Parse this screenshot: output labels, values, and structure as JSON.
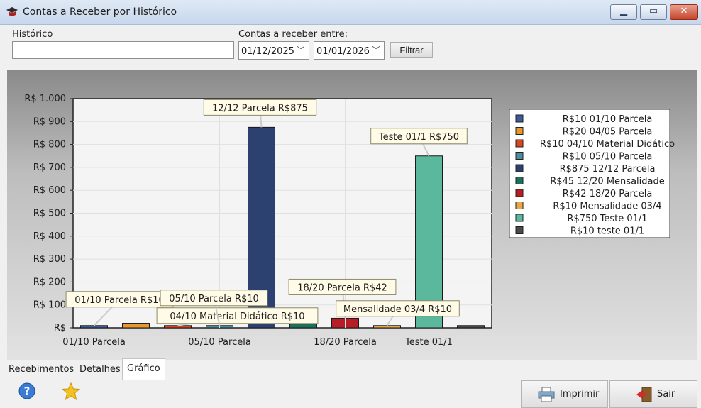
{
  "window": {
    "title": "Contas a Receber por Histórico",
    "minimize_icon": "minimize-icon",
    "maximize_icon": "maximize-icon",
    "close_icon": "close-icon"
  },
  "filters": {
    "historico_label": "Histórico",
    "historico_value": "",
    "period_label": "Contas a receber entre:",
    "date_from": "01/12/2025",
    "date_to": "01/01/2026",
    "filter_button": "Filtrar"
  },
  "chart_data": {
    "type": "bar",
    "y_ticks": [
      "R$ 1.000",
      "R$ 900",
      "R$ 800",
      "R$ 700",
      "R$ 600",
      "R$ 500",
      "R$ 400",
      "R$ 300",
      "R$ 200",
      "R$ 100",
      "R$"
    ],
    "ylim": [
      0,
      1000
    ],
    "x_tick_labels": [
      "01/10 Parcela",
      "05/10 Parcela",
      "18/20 Parcela",
      "Teste 01/1"
    ],
    "grid": true,
    "legend_position": "right",
    "series": [
      {
        "label": "01/10 Parcela",
        "value": 10,
        "color": "#3d5a99",
        "annotation": "01/10 Parcela R$10",
        "legend": "R$10 01/10 Parcela"
      },
      {
        "label": "04/05 Parcela",
        "value": 20,
        "color": "#e8962e",
        "annotation": "",
        "legend": "R$20 04/05 Parcela"
      },
      {
        "label": "04/10 Material Didático",
        "value": 10,
        "color": "#d9471f",
        "annotation": "04/10 Material Didático R$10",
        "legend": "R$10 04/10 Material Didático"
      },
      {
        "label": "05/10 Parcela",
        "value": 10,
        "color": "#4b8f9e",
        "annotation": "05/10 Parcela R$10",
        "legend": "R$10 05/10 Parcela"
      },
      {
        "label": "12/12 Parcela",
        "value": 875,
        "color": "#2d4170",
        "annotation": "12/12 Parcela R$875",
        "legend": "R$875 12/12 Parcela"
      },
      {
        "label": "12/20 Mensalidade",
        "value": 45,
        "color": "#1c6f5a",
        "annotation": "",
        "legend": "R$45 12/20 Mensalidade"
      },
      {
        "label": "18/20 Parcela",
        "value": 42,
        "color": "#b81c24",
        "annotation": "18/20 Parcela R$42",
        "legend": "R$42 18/20 Parcela"
      },
      {
        "label": "Mensalidade 03/4",
        "value": 10,
        "color": "#e6a84a",
        "annotation": "Mensalidade 03/4 R$10",
        "legend": "R$10 Mensalidade 03/4"
      },
      {
        "label": "Teste 01/1",
        "value": 750,
        "color": "#5bb89d",
        "annotation": "Teste 01/1 R$750",
        "legend": "R$750 Teste 01/1"
      },
      {
        "label": "teste 01/1",
        "value": 10,
        "color": "#4a4a4a",
        "annotation": "",
        "legend": "R$10 teste 01/1"
      }
    ]
  },
  "tabs": [
    {
      "label": "Recebimentos"
    },
    {
      "label": "Detalhes"
    },
    {
      "label": "Gráfico"
    }
  ],
  "footer": {
    "help_icon": "help-icon",
    "favorite_icon": "star-icon",
    "print_button": "Imprimir",
    "print_icon": "printer-icon",
    "exit_button": "Sair",
    "exit_icon": "exit-icon"
  }
}
